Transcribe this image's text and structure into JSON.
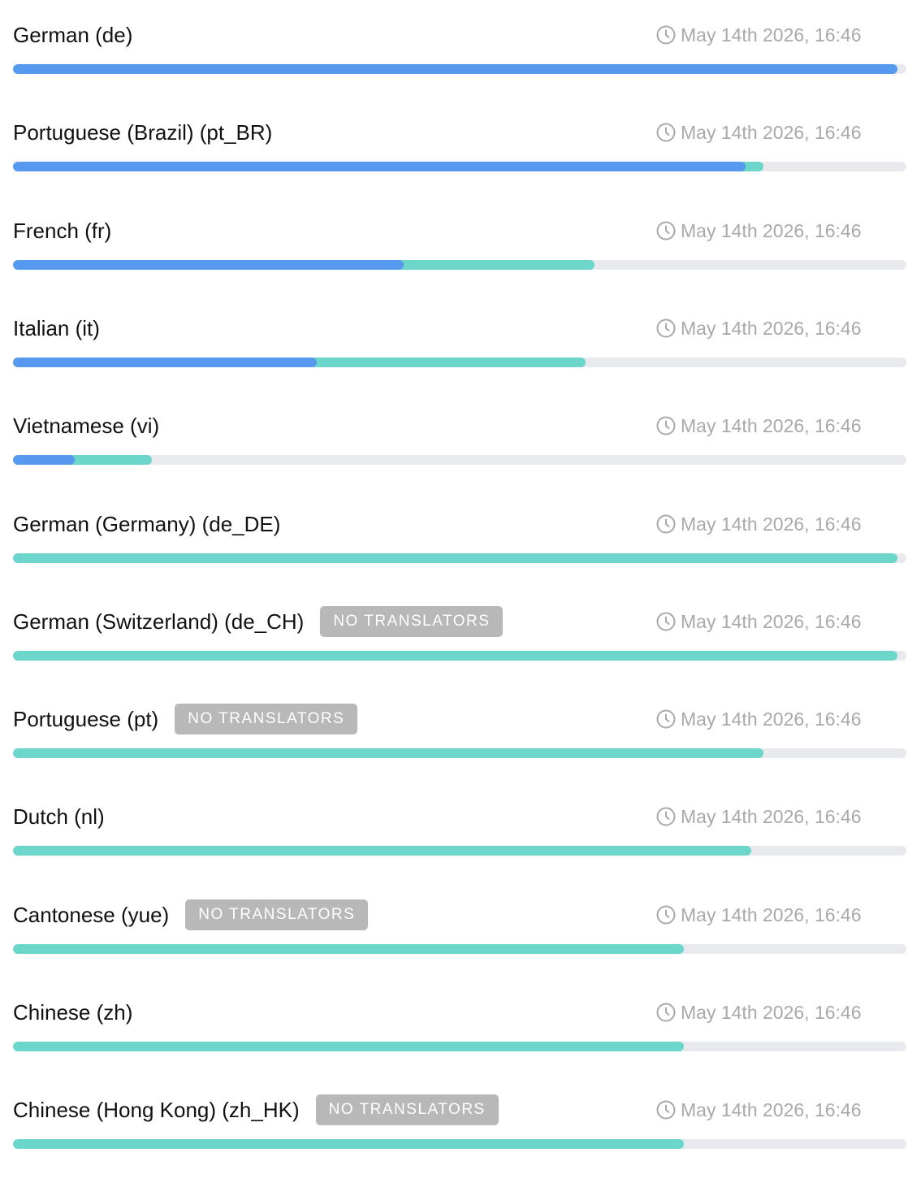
{
  "colors": {
    "approved": "#5799ef",
    "translated": "#6dd6cb",
    "track": "#e9eaee",
    "badge_bg": "#b8b8b8",
    "timestamp_text": "#a9a9a9"
  },
  "languages": [
    {
      "name": "German (de)",
      "badge": "",
      "updated": "May 14th 2026, 16:46",
      "approved": 0.99,
      "translated": 0.99
    },
    {
      "name": "Portuguese (Brazil) (pt_BR)",
      "badge": "",
      "updated": "May 14th 2026, 16:46",
      "approved": 0.82,
      "translated": 0.84
    },
    {
      "name": "French (fr)",
      "badge": "",
      "updated": "May 14th 2026, 16:46",
      "approved": 0.437,
      "translated": 0.651
    },
    {
      "name": "Italian (it)",
      "badge": "",
      "updated": "May 14th 2026, 16:46",
      "approved": 0.34,
      "translated": 0.641
    },
    {
      "name": "Vietnamese (vi)",
      "badge": "",
      "updated": "May 14th 2026, 16:46",
      "approved": 0.069,
      "translated": 0.155
    },
    {
      "name": "German (Germany) (de_DE)",
      "badge": "",
      "updated": "May 14th 2026, 16:46",
      "approved": 0,
      "translated": 0.99
    },
    {
      "name": "German (Switzerland) (de_CH)",
      "badge": "NO TRANSLATORS",
      "updated": "May 14th 2026, 16:46",
      "approved": 0,
      "translated": 0.99
    },
    {
      "name": "Portuguese (pt)",
      "badge": "NO TRANSLATORS",
      "updated": "May 14th 2026, 16:46",
      "approved": 0,
      "translated": 0.84
    },
    {
      "name": "Dutch (nl)",
      "badge": "",
      "updated": "May 14th 2026, 16:46",
      "approved": 0,
      "translated": 0.826
    },
    {
      "name": "Cantonese (yue)",
      "badge": "NO TRANSLATORS",
      "updated": "May 14th 2026, 16:46",
      "approved": 0,
      "translated": 0.751
    },
    {
      "name": "Chinese (zh)",
      "badge": "",
      "updated": "May 14th 2026, 16:46",
      "approved": 0,
      "translated": 0.751
    },
    {
      "name": "Chinese (Hong Kong) (zh_HK)",
      "badge": "NO TRANSLATORS",
      "updated": "May 14th 2026, 16:46",
      "approved": 0,
      "translated": 0.751
    }
  ]
}
